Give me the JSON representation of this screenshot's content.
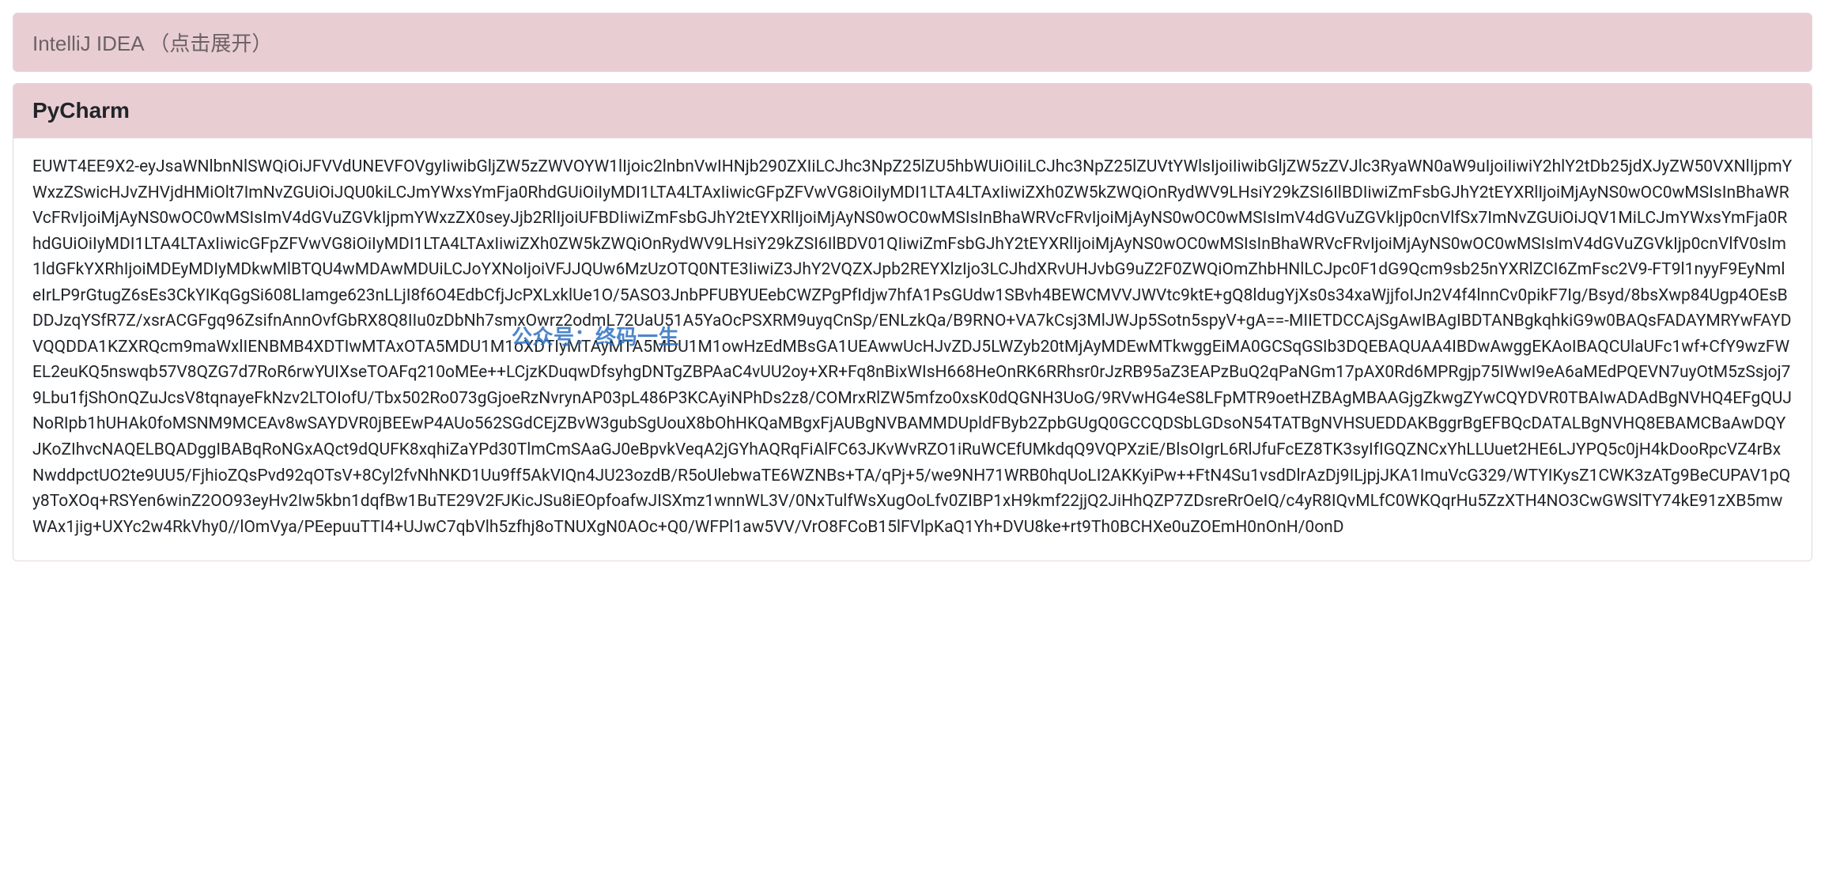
{
  "accordion": {
    "items": [
      {
        "title": "IntelliJ IDEA （点击展开）",
        "expanded": false,
        "body": ""
      },
      {
        "title": "PyCharm",
        "expanded": true,
        "body": "EUWT4EE9X2-eyJsaWNlbnNlSWQiOiJFVVdUNEVFOVgyIiwibGljZW5zZWVOYW1lIjoic2lnbnVwIHNjb290ZXIiLCJhc3NpZ25lZU5hbWUiOiIiLCJhc3NpZ25lZUVtYWlsIjoiIiwibGljZW5zZVJlc3RyaWN0aW9uIjoiIiwiY2hlY2tDb25jdXJyZW50VXNlIjpmYWxzZSwicHJvZHVjdHMiOlt7ImNvZGUiOiJQU0kiLCJmYWxsYmFja0RhdGUiOiIyMDI1LTA4LTAxIiwicGFpZFVwVG8iOiIyMDI1LTA4LTAxIiwiZXh0ZW5kZWQiOnRydWV9LHsiY29kZSI6IlBDIiwiZmFsbGJhY2tEYXRlIjoiMjAyNS0wOC0wMSIsInBhaWRVcFRvIjoiMjAyNS0wOC0wMSIsImV4dGVuZGVkIjpmYWxzZX0seyJjb2RlIjoiUFBDIiwiZmFsbGJhY2tEYXRlIjoiMjAyNS0wOC0wMSIsInBhaWRVcFRvIjoiMjAyNS0wOC0wMSIsImV4dGVuZGVkIjp0cnVlfSx7ImNvZGUiOiJQV1MiLCJmYWxsYmFja0RhdGUiOiIyMDI1LTA4LTAxIiwicGFpZFVwVG8iOiIyMDI1LTA4LTAxIiwiZXh0ZW5kZWQiOnRydWV9LHsiY29kZSI6IlBDV01QIiwiZmFsbGJhY2tEYXRlIjoiMjAyNS0wOC0wMSIsInBhaWRVcFRvIjoiMjAyNS0wOC0wMSIsImV4dGVuZGVkIjp0cnVlfV0sIm1ldGFkYXRhIjoiMDEyMDIyMDkwMlBTQU4wMDAwMDUiLCJoYXNoIjoiVFJJQUw6MzUzOTQ0NTE3IiwiZ3JhY2VQZXJpb2REYXlzIjo3LCJhdXRvUHJvbG9uZ2F0ZWQiOmZhbHNlLCJpc0F1dG9Qcm9sb25nYXRlZCI6ZmFsc2V9-FT9l1nyyF9EyNmleIrLP9rGtugZ6sEs3CkYIKqGgSi608LIamge623nLLjI8f6O4EdbCfjJcPXLxklUe1O/5ASO3JnbPFUBYUEebCWZPgPfIdjw7hfA1PsGUdw1SBvh4BEWCMVVJWVtc9ktE+gQ8ldugYjXs0s34xaWjjfoIJn2V4f4lnnCv0pikF7Ig/Bsyd/8bsXwp84Ugp4OEsBDDJzqYSfR7Z/xsrACGFgq96ZsifnAnnOvfGbRX8Q8IIu0zDbNh7smxOwrz2odmL72UaU51A5YaOcPSXRM9uyqCnSp/ENLzkQa/B9RNO+VA7kCsj3MlJWJp5Sotn5spyV+gA==-MIIETDCCAjSgAwIBAgIBDTANBgkqhkiG9w0BAQsFADAYMRYwFAYDVQQDDA1KZXRQcm9maWxlIENBMB4XDTIwMTAxOTA5MDU1M1oXDTIyMTAyMTA5MDU1M1owHzEdMBsGA1UEAwwUcHJvZDJ5LWZyb20tMjAyMDEwMTkwggEiMA0GCSqGSIb3DQEBAQUAA4IBDwAwggEKAoIBAQCUlaUFc1wf+CfY9wzFWEL2euKQ5nswqb57V8QZG7d7RoR6rwYUIXseTOAFq210oMEe++LCjzKDuqwDfsyhgDNTgZBPAaC4vUU2oy+XR+Fq8nBixWIsH668HeOnRK6RRhsr0rJzRB95aZ3EAPzBuQ2qPaNGm17pAX0Rd6MPRgjp75IWwI9eA6aMEdPQEVN7uyOtM5zSsjoj79Lbu1fjShOnQZuJcsV8tqnayeFkNzv2LTOIofU/Tbx502Ro073gGjoeRzNvrynAP03pL486P3KCAyiNPhDs2z8/COMrxRlZW5mfzo0xsK0dQGNH3UoG/9RVwHG4eS8LFpMTR9oetHZBAgMBAAGjgZkwgZYwCQYDVR0TBAIwADAdBgNVHQ4EFgQUJNoRIpb1hUHAk0foMSNM9MCEAv8wSAYDVR0jBEEwP4AUo562SGdCEjZBvW3gubSgUouX8bOhHKQaMBgxFjAUBgNVBAMMDUpldFByb2ZpbGUgQ0GCCQDSbLGDsoN54TATBgNVHSUEDDAKBggrBgEFBQcDATALBgNVHQ8EBAMCBaAwDQYJKoZIhvcNAQELBQADggIBABqRoNGxAQct9dQUFK8xqhiZaYPd30TlmCmSAaGJ0eBpvkVeqA2jGYhAQRqFiAlFC63JKvWvRZO1iRuWCEfUMkdqQ9VQPXziE/BlsOIgrL6RlJfuFcEZ8TK3syIfIGQZNCxYhLLUuet2HE6LJYPQ5c0jH4kDooRpcVZ4rBxNwddpctUO2te9UU5/FjhioZQsPvd92qOTsV+8Cyl2fvNhNKD1Uu9ff5AkVIQn4JU23ozdB/R5oUlebwaTE6WZNBs+TA/qPj+5/we9NH71WRB0hqUoLI2AKKyiPw++FtN4Su1vsdDlrAzDj9ILjpjJKA1ImuVcG329/WTYIKysZ1CWK3zATg9BeCUPAV1pQy8ToXOq+RSYen6winZ2OO93eyHv2Iw5kbn1dqfBw1BuTE29V2FJKicJSu8iEOpfoafwJISXmz1wnnWL3V/0NxTulfWsXugOoLfv0ZIBP1xH9kmf22jjQ2JiHhQZP7ZDsreRrOeIQ/c4yR8IQvMLfC0WKQqrHu5ZzXTH4NO3CwGWSlTY74kE91zXB5mwWAx1jig+UXYc2w4RkVhy0//lOmVya/PEepuuTTI4+UJwC7qbVlh5zfhj8oTNUXgN0AOc+Q0/WFPl1aw5VV/VrO8FCoB15lFVlpKaQ1Yh+DVU8ke+rt9Th0BCHXe0uZOEmH0nOnH/0onD"
      }
    ]
  },
  "watermark": "公众号：终码一生"
}
